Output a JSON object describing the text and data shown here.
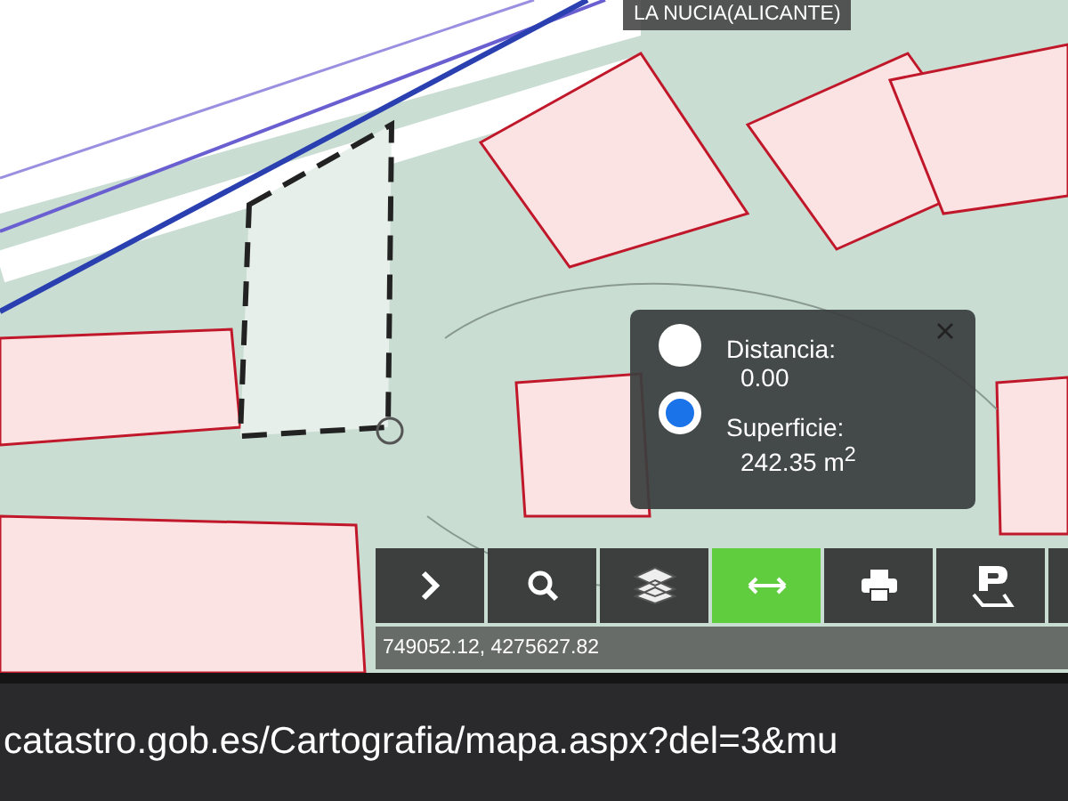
{
  "map": {
    "place_label": "LA NUCIA(ALICANTE)"
  },
  "measure_panel": {
    "options": [
      {
        "label": "Distancia:",
        "value": "0.00",
        "selected": false
      },
      {
        "label": "Superficie:",
        "value": "242.35 m$^{2}$",
        "selected": true
      }
    ]
  },
  "toolbar": {
    "buttons": [
      {
        "kind": "chevron",
        "selected": false
      },
      {
        "kind": "search",
        "selected": false
      },
      {
        "kind": "layers",
        "selected": false
      },
      {
        "kind": "measure",
        "selected": true
      },
      {
        "kind": "print",
        "selected": false
      },
      {
        "kind": "parcel",
        "selected": false
      },
      {
        "kind": "blank",
        "selected": false
      }
    ]
  },
  "coordinates": "749052.12, 4275627.82",
  "address_bar": {
    "url": "catastro.gob.es/Cartografia/mapa.aspx?del=3&mu"
  }
}
